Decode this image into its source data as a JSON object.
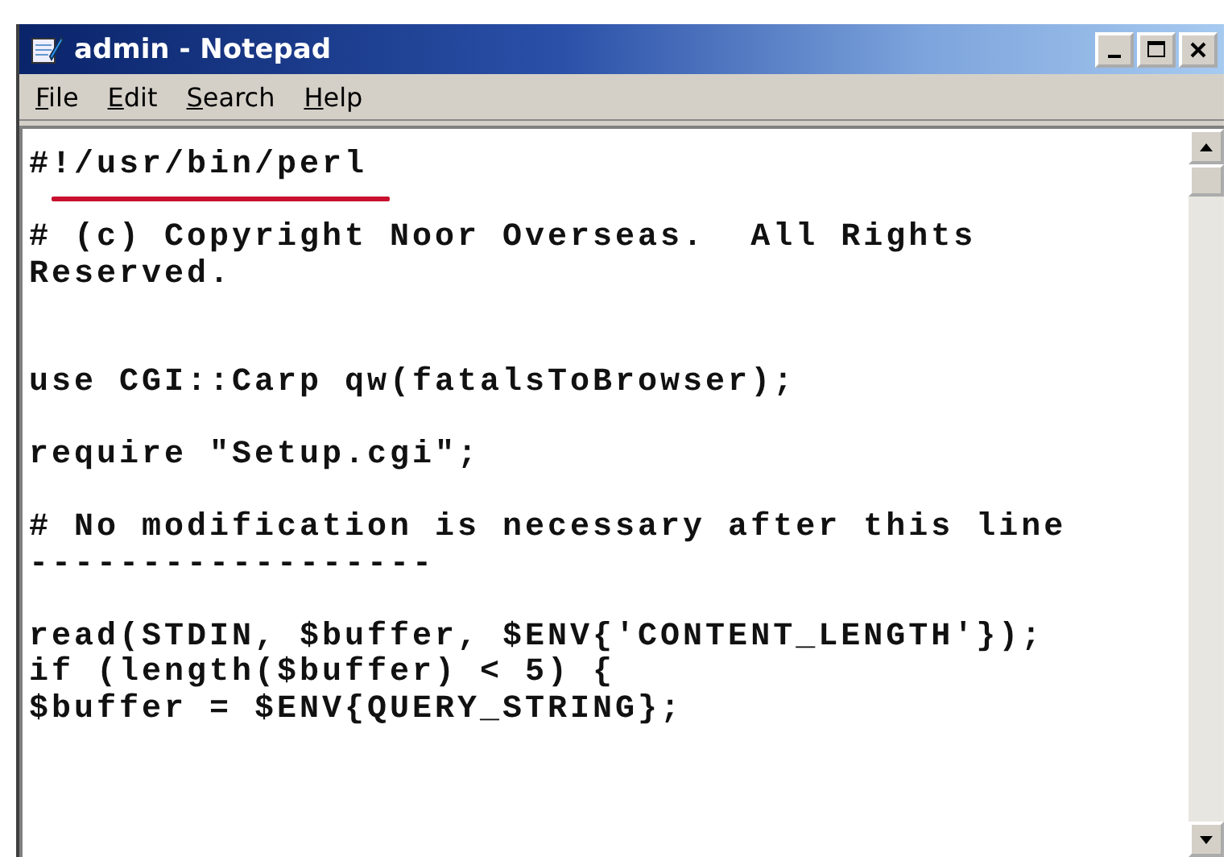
{
  "window": {
    "title": "admin - Notepad"
  },
  "menu": [
    "File",
    "Edit",
    "Search",
    "Help"
  ],
  "lines": [
    {
      "kind": "code",
      "text": "#!/usr/bin/perl",
      "marked": true
    },
    {
      "kind": "blank",
      "marked": false
    },
    {
      "kind": "code",
      "text": "# (c) Copyright Noor Overseas.  All Rights",
      "marked": false
    },
    {
      "kind": "code",
      "text": "Reserved.",
      "marked": false
    },
    {
      "kind": "blank",
      "marked": false
    },
    {
      "kind": "blank",
      "marked": false
    },
    {
      "kind": "code",
      "text": "use CGI::Carp qw(fatalsToBrowser);",
      "marked": false
    },
    {
      "kind": "blank",
      "marked": false
    },
    {
      "kind": "code",
      "text": "require \"Setup.cgi\";",
      "marked": false
    },
    {
      "kind": "blank",
      "marked": false
    },
    {
      "kind": "code",
      "text": "# No modification is necessary after this line",
      "marked": false
    },
    {
      "kind": "code",
      "text": "------------------",
      "marked": false
    },
    {
      "kind": "blank",
      "marked": false
    },
    {
      "kind": "code",
      "text": "read(STDIN, $buffer, $ENV{'CONTENT_LENGTH'});",
      "marked": false
    },
    {
      "kind": "code",
      "text": "if (length($buffer) < 5) {",
      "marked": false
    },
    {
      "kind": "code",
      "text": "$buffer = $ENV{QUERY_STRING};",
      "marked": false
    }
  ]
}
